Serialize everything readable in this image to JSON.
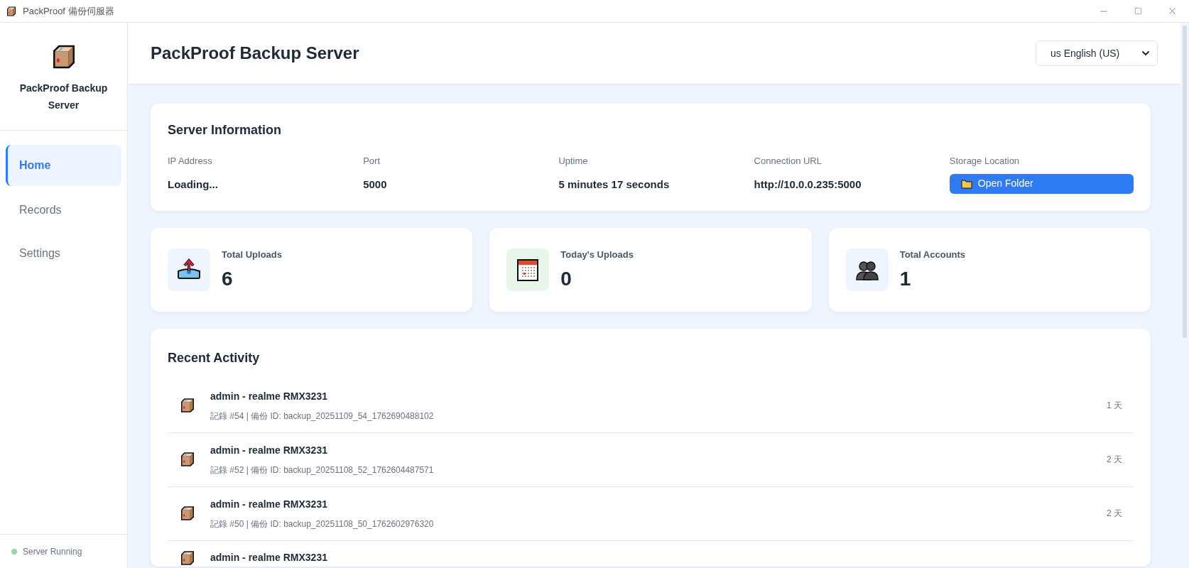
{
  "window": {
    "title": "PackProof 備份伺服器"
  },
  "sidebar": {
    "app_name": "PackProof Backup Server",
    "items": [
      {
        "label": "Home",
        "selected": true
      },
      {
        "label": "Records",
        "selected": false
      },
      {
        "label": "Settings",
        "selected": false
      }
    ],
    "status": {
      "label": "Server Running",
      "running": true
    }
  },
  "header": {
    "title": "PackProof Backup Server",
    "language": "us English (US)"
  },
  "server_info": {
    "title": "Server Information",
    "fields": [
      {
        "kind": "text",
        "label": "IP Address",
        "value": "Loading..."
      },
      {
        "kind": "text",
        "label": "Port",
        "value": "5000"
      },
      {
        "kind": "text",
        "label": "Uptime",
        "value": "5 minutes 17 seconds"
      },
      {
        "kind": "text",
        "label": "Connection URL",
        "value": "http://10.0.0.235:5000"
      },
      {
        "kind": "button",
        "label": "Storage Location",
        "value": "Open Folder"
      }
    ]
  },
  "stats": [
    {
      "kind": "upload",
      "label": "Total Uploads",
      "value": "6"
    },
    {
      "kind": "calendar",
      "label": "Today's Uploads",
      "value": "0"
    },
    {
      "kind": "accounts",
      "label": "Total Accounts",
      "value": "1"
    }
  ],
  "recent_activity": {
    "title": "Recent Activity",
    "items": [
      {
        "title": "admin - realme RMX3231",
        "detail": "記錄 #54 | 備份 ID: backup_20251109_54_1762690488102",
        "time": "1 天"
      },
      {
        "title": "admin - realme RMX3231",
        "detail": "記錄 #52 | 備份 ID: backup_20251108_52_1762604487571",
        "time": "2 天"
      },
      {
        "title": "admin - realme RMX3231",
        "detail": "記錄 #50 | 備份 ID: backup_20251108_50_1762602976320",
        "time": "2 天"
      },
      {
        "title": "admin - realme RMX3231"
      }
    ]
  }
}
